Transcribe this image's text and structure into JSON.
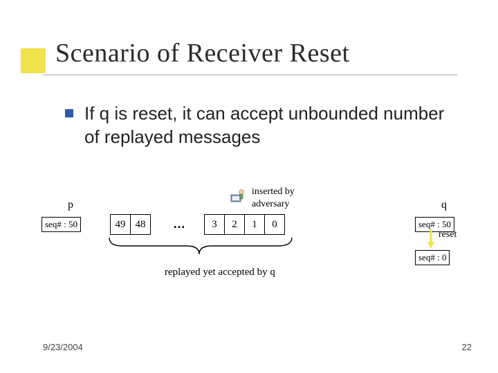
{
  "title": "Scenario of Receiver Reset",
  "bullet": "If q is reset, it can accept unbounded number of replayed messages",
  "diagram": {
    "inserted_by": "inserted by",
    "adversary": "adversary",
    "p_label": "p",
    "q_label": "q",
    "seq_p": "seq# : 50",
    "seq_q_before": "seq# : 50",
    "seq_q_after": "seq# : 0",
    "reset_label": "reset",
    "msgs_left": [
      "49",
      "48"
    ],
    "msgs_right": [
      "3",
      "2",
      "1",
      "0"
    ],
    "dots": "…",
    "replayed_label": "replayed yet accepted by q"
  },
  "footer": {
    "date": "9/23/2004",
    "page": "22"
  }
}
